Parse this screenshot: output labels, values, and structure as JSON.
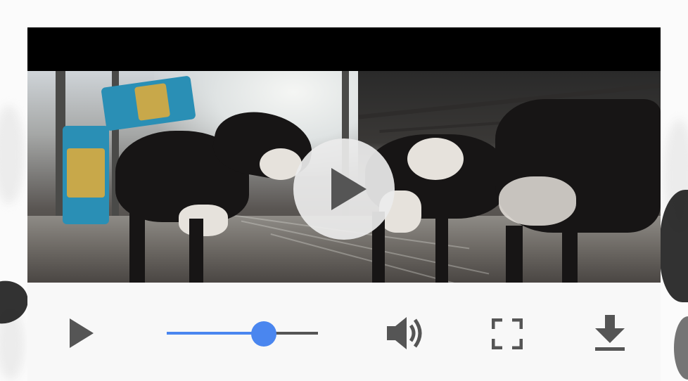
{
  "player": {
    "video": {
      "scene": "dairy-barn-cows",
      "big_play_icon": "play-icon"
    },
    "controls": {
      "play_icon": "play-icon",
      "seek_progress_fraction": 0.64,
      "volume_icon": "volume-icon",
      "fullscreen_icon": "fullscreen-icon",
      "download_icon": "download-icon"
    },
    "colors": {
      "accent": "#4a86ef",
      "icon": "#555555",
      "controls_background": "#f8f8f8",
      "letterbox": "#000000"
    }
  }
}
